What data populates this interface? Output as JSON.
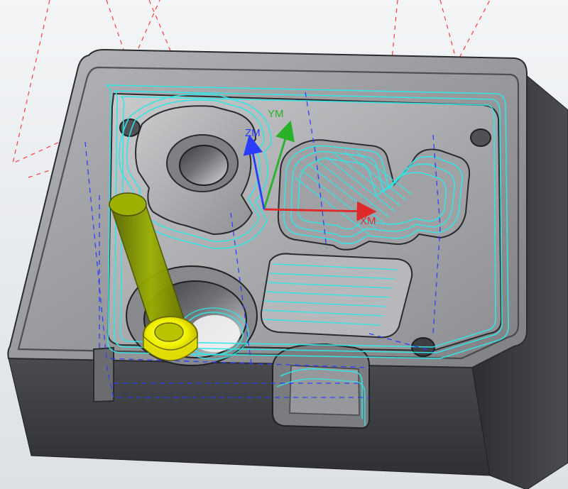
{
  "viewport": {
    "background_top": "#f3f5f7",
    "background_bottom": "#dde1e5"
  },
  "colors": {
    "part_top": "#9a9c9f",
    "part_dark": "#3b3c3f",
    "toolpath": "#32e6e6",
    "feed_path": "#2a3cff",
    "rapid_path": "#ff2a2a",
    "axis_x": "#e02a2a",
    "axis_y": "#29b229",
    "axis_z": "#2a3cff",
    "tool_shank": "#8aa000",
    "tool_holder": "#f0f000"
  },
  "axes": {
    "x_label": "XM",
    "y_label": "YM",
    "z_label": "ZM"
  },
  "tool": {
    "icon": "end-mill-tool-icon"
  }
}
